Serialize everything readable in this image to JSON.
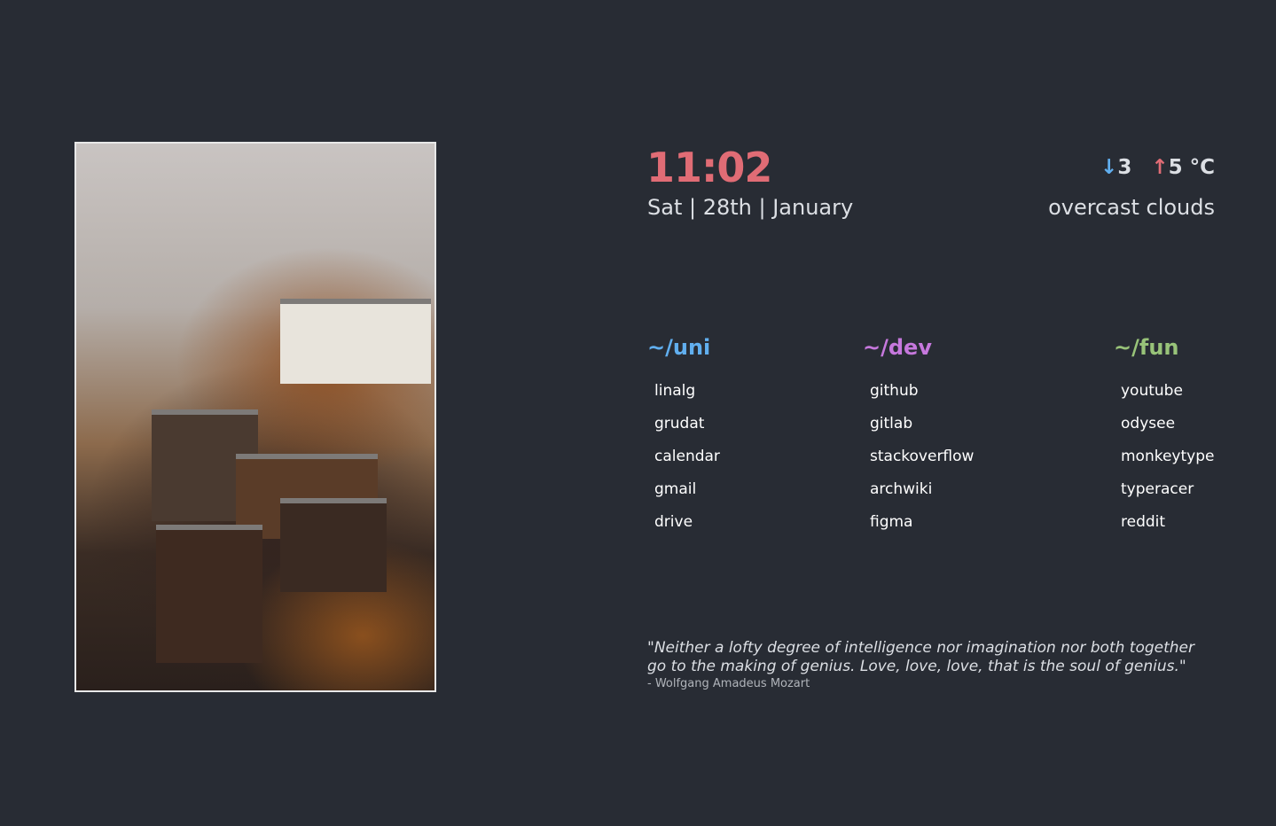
{
  "clock": {
    "time": "11:02",
    "date": "Sat | 28th | January"
  },
  "weather": {
    "low_arrow": "↓",
    "low": "3",
    "high_arrow": "↑",
    "high": "5 °C",
    "description": "overcast clouds"
  },
  "columns": [
    {
      "title": "~/uni",
      "color": "#61afef",
      "links": [
        "linalg",
        "grudat",
        "calendar",
        "gmail",
        "drive"
      ]
    },
    {
      "title": "~/dev",
      "color": "#c678dd",
      "links": [
        "github",
        "gitlab",
        "stackoverflow",
        "archwiki",
        "figma"
      ]
    },
    {
      "title": "~/fun",
      "color": "#98c379",
      "links": [
        "youtube",
        "odysee",
        "monkeytype",
        "typeracer",
        "reddit"
      ]
    }
  ],
  "quote": {
    "text": "\"Neither a lofty degree of intelligence nor imagination nor both together go to the making of genius. Love, love, love, that is the soul of genius.\"",
    "author": "- Wolfgang Amadeus Mozart"
  },
  "colors": {
    "background": "#282c34",
    "accent": "#e06c75"
  }
}
